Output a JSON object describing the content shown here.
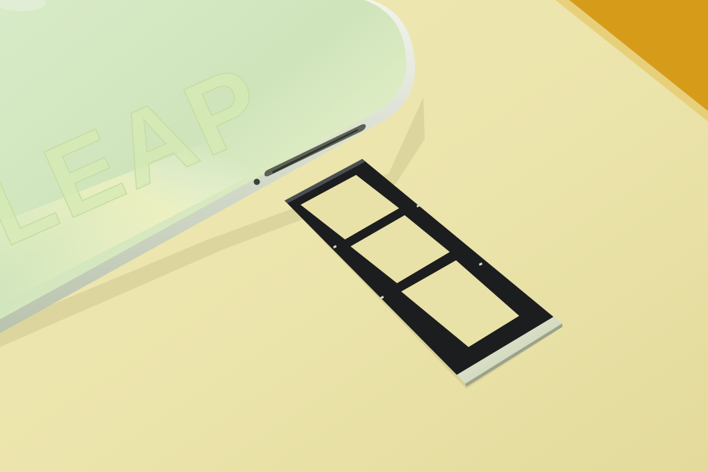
{
  "scene": {
    "description_label": "",
    "phone": {
      "back_print": "LEAP",
      "body_color": "#cfe3bd",
      "frame_color": "#dfe7d6"
    },
    "sim_tray": {
      "slot_count": 3,
      "tray_color": "#1b1d1f",
      "ejector_color": "#dfe6cc"
    },
    "background_color": "#e9e2a8",
    "corner_accent_color": "#d79b1a"
  }
}
